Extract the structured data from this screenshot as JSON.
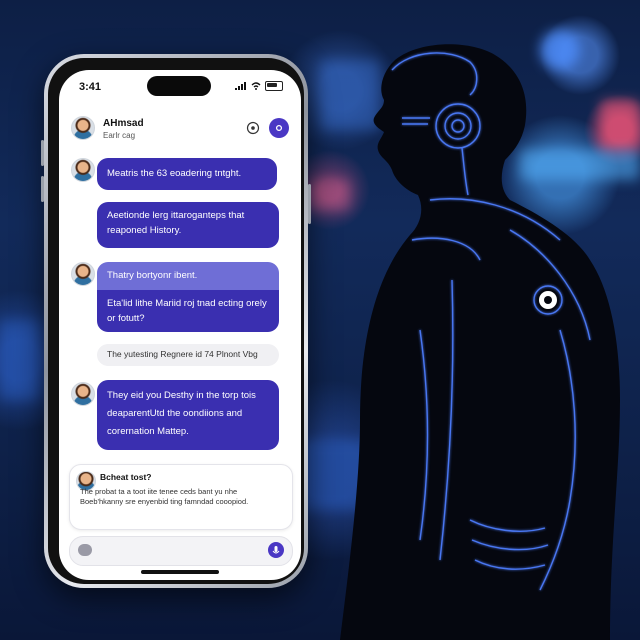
{
  "status_bar": {
    "time": "3:41"
  },
  "contact": {
    "name": "AHmsad",
    "subtitle": "Earlr cag"
  },
  "messages": [
    {
      "id": "m1",
      "text": "Meatris the 63 eoadering tntght."
    },
    {
      "id": "m2",
      "text": "Aeetionde lerg ittaroganteps that reaponed History."
    },
    {
      "id": "m3a",
      "text": "Thatry bortyonr ibent."
    },
    {
      "id": "m3b",
      "text": "Eta'lid lithe Mariid roj tnad ecting orely or fotutt?"
    },
    {
      "id": "m4",
      "text": "The yutesting Regnere id 74 Plnont Vbg"
    },
    {
      "id": "m5",
      "text": "They eid you Desthy in the torp tois deaparentUtd the oondiions and corernation Mattep."
    }
  ],
  "card": {
    "title": "Bcheat tost?",
    "text": "The probat ta a toot iite tenee ceds bant yu nhe Boeb'hkanny sre enyenbid ting famndad cooopiod."
  },
  "icons": {
    "avatar": "avatar-icon",
    "phone": "phone-icon",
    "menu": "more-icon",
    "attach": "attachment-icon",
    "mic": "microphone-icon"
  },
  "colors": {
    "bubble": "#3a2fb0",
    "bubble_light": "#6f6ed6",
    "accent": "#4a37c4",
    "scene_glow": "#3a78ff"
  }
}
